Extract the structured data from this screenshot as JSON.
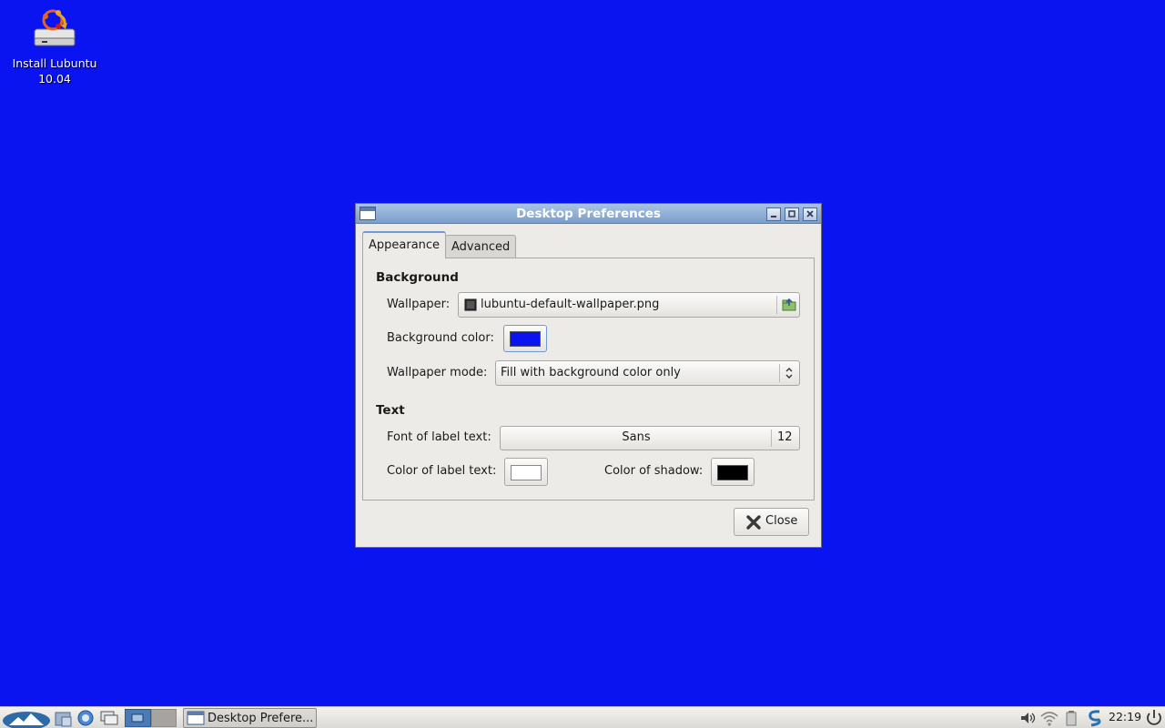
{
  "desktop": {
    "background_color": "#0a14f0",
    "icon": {
      "label_line1": "Install Lubuntu",
      "label_line2": "10.04",
      "icon": "installer-drive-icon"
    }
  },
  "dialog": {
    "title": "Desktop Preferences",
    "tabs": [
      {
        "label": "Appearance",
        "active": true
      },
      {
        "label": "Advanced",
        "active": false
      }
    ],
    "background_section": {
      "heading": "Background",
      "wallpaper_label": "Wallpaper:",
      "wallpaper_value": "lubuntu-default-wallpaper.png",
      "background_color_label": "Background color:",
      "background_color": "#0a14f0",
      "wallpaper_mode_label": "Wallpaper mode:",
      "wallpaper_mode_value": "Fill with background color only"
    },
    "text_section": {
      "heading": "Text",
      "font_label": "Font of label text:",
      "font_name": "Sans",
      "font_size": "12",
      "label_color_label": "Color of label text:",
      "label_color": "#ffffff",
      "shadow_color_label": "Color of shadow:",
      "shadow_color": "#000000"
    },
    "close_button": {
      "label": "Close"
    }
  },
  "taskbar": {
    "task_label": "Desktop Prefere...",
    "clock": "22:19"
  }
}
